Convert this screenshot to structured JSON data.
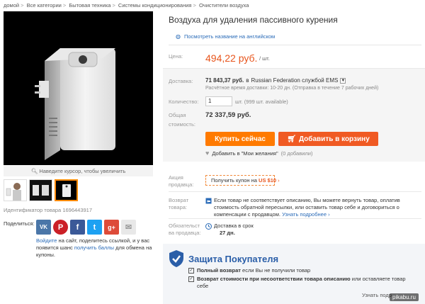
{
  "breadcrumb": [
    "домой",
    "Все категории",
    "Бытовая техника",
    "Системы кондиционирования",
    "Очистители воздуха"
  ],
  "breadcrumb_separator": ">",
  "product": {
    "title": "Воздуха для удаления пассивного курения",
    "translate_link": "Посмотреть название на английском",
    "zoom_hint": "Наведите курсор, чтобы увеличить",
    "id_label": "Идентификатор товара 1696443917"
  },
  "price": {
    "label": "Цена:",
    "value": "494,22 руб.",
    "unit": "/ шт."
  },
  "shipping": {
    "label": "Доставка:",
    "cost": "71 843,37 руб.",
    "in_word": "в",
    "destination": "Russian Federation службой EMS",
    "time": "Расчётное время доставки: 10-20 дн. (Отправка в течение 7 рабочих дней)"
  },
  "quantity": {
    "label": "Количество:",
    "value": "1",
    "info": "шт. (999 шт. available)"
  },
  "total": {
    "label_line1": "Общая",
    "label_line2": "стоимость:",
    "value": "72 337,59 руб."
  },
  "buttons": {
    "buy_now": "Купить сейчас",
    "add_to_cart": "Добавить в корзину"
  },
  "wishlist": {
    "label": "Добавить в \"Мои желания\"",
    "count": "(0 добавили)"
  },
  "promo": {
    "label_line1": "Акция",
    "label_line2": "продавца:",
    "coupon_prefix": "Получить купон на",
    "coupon_value": "US $10",
    "coupon_arrow": "›"
  },
  "returns": {
    "label_line1": "Возврат",
    "label_line2": "товара:",
    "text": "Если товар не соответствует описанию, Вы можете вернуть товар, оплатив стоимость обратной пересылки, или оставить товар себе и договориться о компенсации с продавцом.",
    "link": "Узнать подробнее ›"
  },
  "delivery_guarantee": {
    "label_line1": "Обязательст",
    "label_line2": "ва продавца:",
    "line1": "Доставка в срок",
    "line2": "27 дн."
  },
  "share": {
    "label": "Поделиться:",
    "icons": [
      {
        "name": "vk-icon",
        "glyph": "VK",
        "color": "#4a76a8"
      },
      {
        "name": "pinterest-icon",
        "glyph": "P",
        "color": "#cb2027"
      },
      {
        "name": "facebook-icon",
        "glyph": "f",
        "color": "#3b5998"
      },
      {
        "name": "twitter-icon",
        "glyph": "t",
        "color": "#1da1f2"
      },
      {
        "name": "google-plus-icon",
        "glyph": "g+",
        "color": "#dd4b39"
      },
      {
        "name": "email-icon",
        "glyph": "✉",
        "color": "#cfcfcf"
      }
    ],
    "note_login": "Войдите",
    "note_mid": "на сайт, поделитесь ссылкой, и у вас появится шанс",
    "note_points": "получить баллы",
    "note_end": "для обмена на купоны."
  },
  "protection": {
    "title": "Защита Покупателя",
    "item1_bold": "Полный возврат",
    "item1_rest": "если Вы не получили товар",
    "item2_bold": "Возврат стоимости при несоответствии товара описанию",
    "item2_rest": "или оставляете товар себе",
    "learn_more": "Узнать подр"
  },
  "watermark": "pikabu.ru",
  "colors": {
    "price": "#e8551c",
    "buy_button": "#ff7a00",
    "cart_button": "#f05a23",
    "link": "#2a6bb8",
    "protection_title": "#2a5ea8"
  }
}
